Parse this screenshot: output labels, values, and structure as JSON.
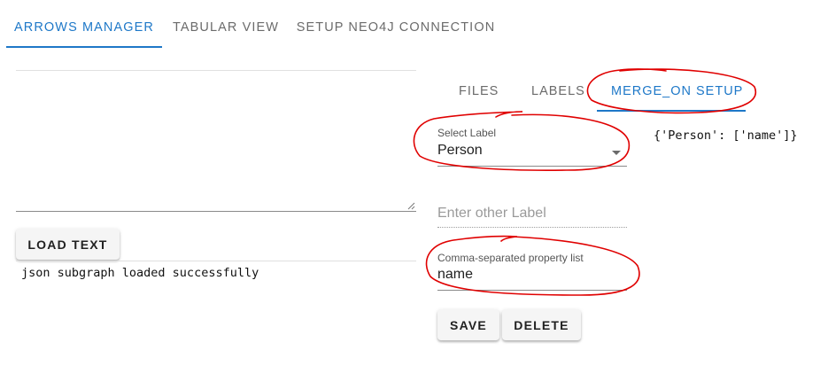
{
  "top_tabs": {
    "arrows_manager": "ARROWS MANAGER",
    "tabular_view": "TABULAR VIEW",
    "setup_neo4j": "SETUP NEO4J CONNECTION",
    "active": "ARROWS MANAGER"
  },
  "left": {
    "textarea_value": "",
    "load_button": "LOAD TEXT",
    "status": "json subgraph loaded successfully"
  },
  "inner_tabs": {
    "files": "FILES",
    "labels": "LABELS",
    "merge_on_setup": "MERGE_ON SETUP",
    "active": "MERGE_ON SETUP"
  },
  "merge_setup": {
    "select_label": {
      "label": "Select Label",
      "value": "Person"
    },
    "other_label": {
      "placeholder": "Enter other Label",
      "value": ""
    },
    "property_list": {
      "label": "Comma-separated property list",
      "value": "name"
    },
    "mapping_text": "{'Person': ['name']}",
    "save_button": "SAVE",
    "delete_button": "DELETE"
  },
  "colors": {
    "accent": "#1e78c8",
    "annotation": "#e00000"
  }
}
